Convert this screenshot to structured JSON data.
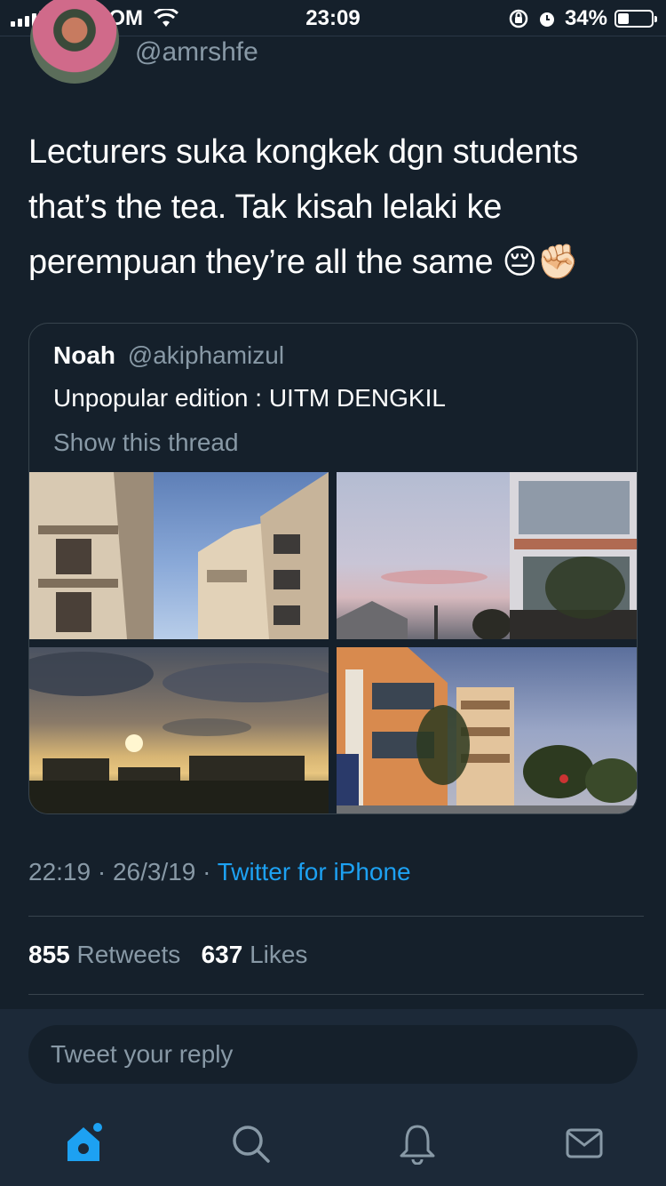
{
  "status_bar": {
    "carrier": "CELCOM",
    "time": "23:09",
    "battery": "34%",
    "battery_level": 0.34
  },
  "tweet": {
    "handle": "@amrshfe",
    "text": "Lecturers suka kongkek dgn students that’s the tea. Tak kisah lelaki ke perempuan they’re all the same 😔✊🏻",
    "timestamp": "22:19 · 26/3/19 · ",
    "source": "Twitter for iPhone",
    "retweet_count": "855",
    "retweets_label": "Retweets",
    "like_count": "637",
    "likes_label": "Likes"
  },
  "quote": {
    "name": "Noah",
    "handle": "@akiphamizul",
    "text": "Unpopular edition : UITM DENGKIL",
    "show_thread": "Show this thread"
  },
  "reply": {
    "placeholder": "Tweet your reply"
  },
  "tabbar": {
    "items": [
      "home-icon",
      "search-icon",
      "notifications-icon",
      "messages-icon"
    ],
    "active_color": "#1da1f2",
    "inactive_color": "#8899a6"
  }
}
